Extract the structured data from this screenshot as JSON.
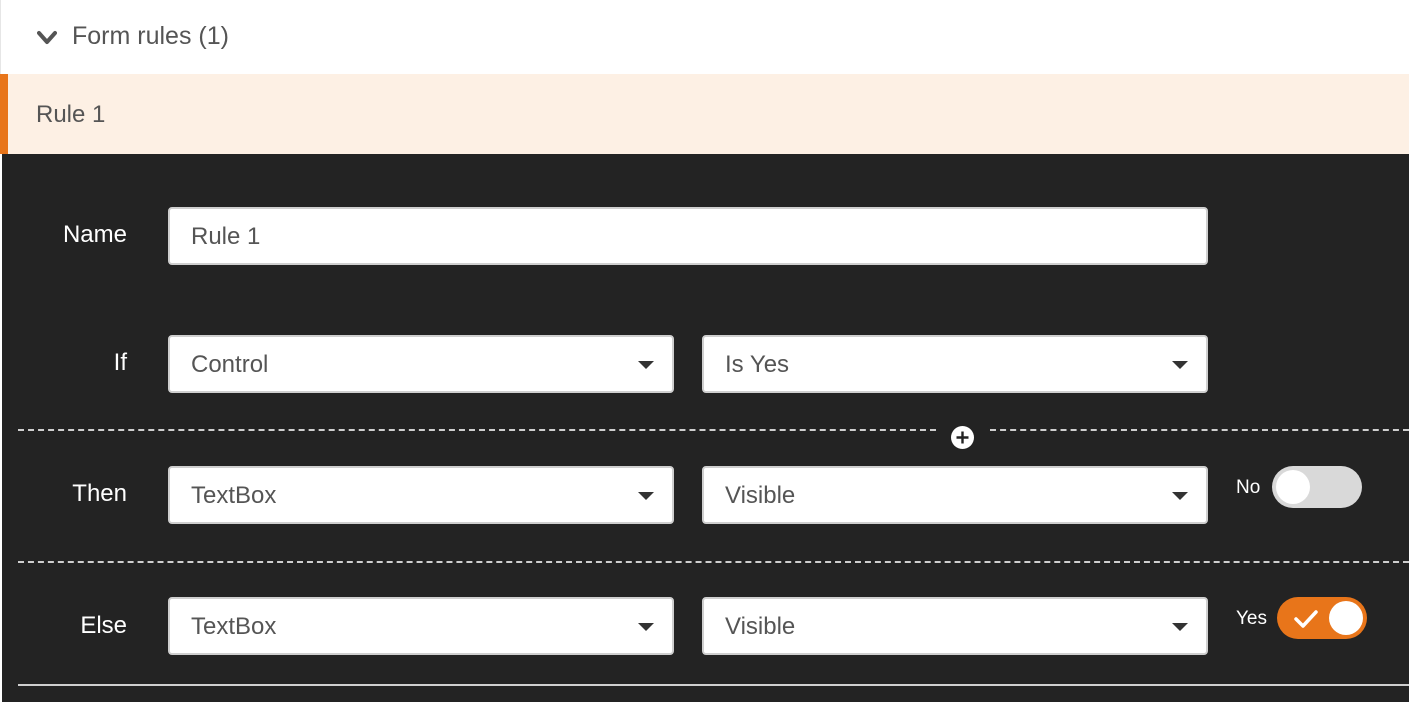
{
  "section": {
    "title": "Form rules (1)",
    "chevron_icon": "chevron-down-icon"
  },
  "rule_tab": {
    "label": "Rule 1",
    "accent_color": "#e8751a"
  },
  "editor": {
    "name_label": "Name",
    "name_value": "Rule 1",
    "if": {
      "label": "If",
      "field": "Control",
      "condition": "Is Yes"
    },
    "then": {
      "label": "Then",
      "field": "TextBox",
      "action": "Visible",
      "toggle_label": "No",
      "toggle_on": false
    },
    "else": {
      "label": "Else",
      "field": "TextBox",
      "action": "Visible",
      "toggle_label": "Yes",
      "toggle_on": true
    }
  },
  "colors": {
    "panel_bg": "#232323",
    "toggle_on": "#e8751a",
    "toggle_off": "#d9d9d9"
  }
}
